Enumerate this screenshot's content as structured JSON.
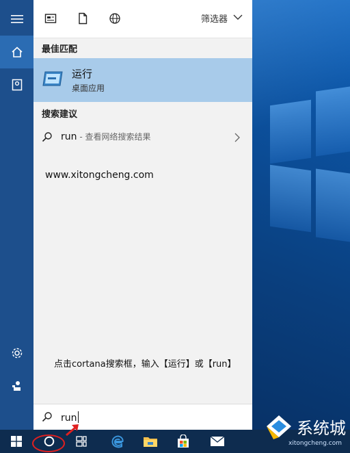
{
  "topbar": {
    "filter_label": "筛选器",
    "icons": [
      "app-grid-icon",
      "document-icon",
      "globe-icon",
      "chevron-down-icon"
    ]
  },
  "rail": {
    "icons": [
      "hamburger-icon",
      "home-icon",
      "notebook-icon",
      "gear-icon",
      "feedback-icon"
    ]
  },
  "best_match": {
    "section_title": "最佳匹配",
    "app_title": "运行",
    "app_subtitle": "桌面应用"
  },
  "suggestions": {
    "section_title": "搜索建议",
    "query": "run",
    "description": " - 查看网络搜索结果"
  },
  "site_text": "www.xitongcheng.com",
  "instruction": "点击cortana搜索框，输入【运行】或【run】",
  "search": {
    "value": "run"
  },
  "taskbar": {
    "icons": [
      "windows-start-icon",
      "cortana-circle-icon",
      "task-view-icon",
      "edge-icon",
      "file-explorer-icon",
      "store-icon",
      "mail-icon"
    ]
  },
  "watermark": {
    "title": "系统城",
    "subtitle": "xitongcheng.com"
  },
  "colors": {
    "accent": "#2b6cb3",
    "selection": "#a8cbea",
    "rail": "#1d4f8c",
    "taskbar": "#0e2c4f",
    "annotation_red": "#e02020"
  }
}
